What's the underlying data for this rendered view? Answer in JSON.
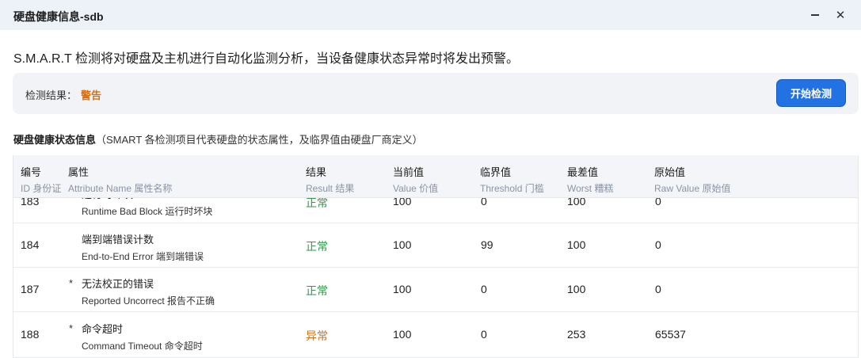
{
  "window": {
    "title": "硬盘健康信息-sdb"
  },
  "intro": "S.M.A.R.T 检测将对硬盘及主机进行自动化监测分析，当设备健康状态异常时将发出预警。",
  "result": {
    "label": "检测结果：",
    "value": "警告",
    "button": "开始检测"
  },
  "section": {
    "title": "硬盘健康状态信息",
    "subtitle": "（SMART 各检测项目代表硬盘的状态属性，及临界值由硬盘厂商定义）"
  },
  "columns": [
    {
      "zh": "编号",
      "en": "ID  身份证"
    },
    {
      "zh": "属性",
      "en": "Attribute Name  属性名称"
    },
    {
      "zh": "结果",
      "en": "Result  结果"
    },
    {
      "zh": "当前值",
      "en": "Value  价值"
    },
    {
      "zh": "临界值",
      "en": "Threshold  门槛"
    },
    {
      "zh": "最差值",
      "en": "Worst  糟糕"
    },
    {
      "zh": "原始值",
      "en": "Raw Value  原始值"
    }
  ],
  "rows": [
    {
      "id": "183",
      "star": "",
      "name_zh": "运行时坏块",
      "name_en": "Runtime Bad Block  运行时坏块",
      "result": "正常",
      "status": "ok",
      "value": "100",
      "threshold": "0",
      "worst": "100",
      "raw": "0"
    },
    {
      "id": "184",
      "star": "",
      "name_zh": "端到端错误计数",
      "name_en": "End-to-End Error  端到端错误",
      "result": "正常",
      "status": "ok",
      "value": "100",
      "threshold": "99",
      "worst": "100",
      "raw": "0"
    },
    {
      "id": "187",
      "star": "*",
      "name_zh": "无法校正的错误",
      "name_en": "Reported Uncorrect  报告不正确",
      "result": "正常",
      "status": "ok",
      "value": "100",
      "threshold": "0",
      "worst": "100",
      "raw": "0"
    },
    {
      "id": "188",
      "star": "*",
      "name_zh": "命令超时",
      "name_en": "Command Timeout  命令超时",
      "result": "异常",
      "status": "bad",
      "value": "100",
      "threshold": "0",
      "worst": "253",
      "raw": "65537"
    }
  ]
}
